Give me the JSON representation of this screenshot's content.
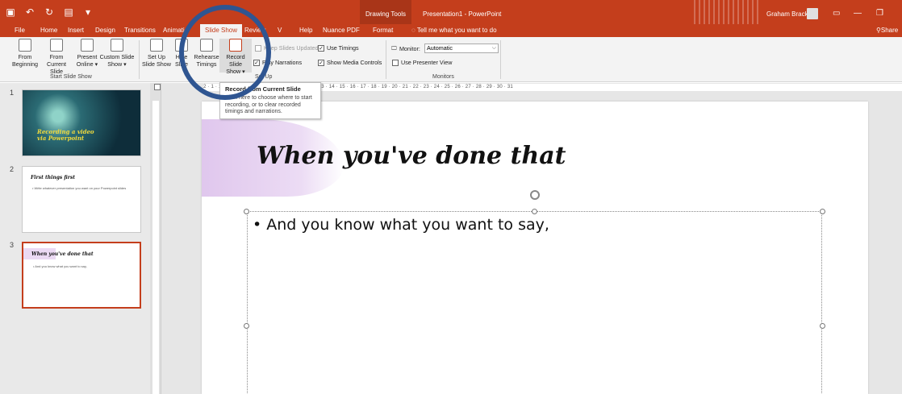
{
  "titlebar": {
    "qat_icons": [
      "save-icon",
      "undo-icon",
      "redo-icon",
      "start-from-beginning-icon",
      "customize-qat-icon"
    ],
    "contextual_tab": "Drawing Tools",
    "title": "Presentation1  -  PowerPoint",
    "user": "Graham Brack"
  },
  "tabs": {
    "items": [
      "File",
      "Home",
      "Insert",
      "Design",
      "Transitions",
      "Animati",
      "Slide Show",
      "Review",
      "V",
      "Help",
      "Nuance PDF",
      "Format"
    ],
    "active": "Slide Show",
    "tell_me": "Tell me what you want to do",
    "share": "Share"
  },
  "ribbon": {
    "from_beginning": [
      "From",
      "Beginning"
    ],
    "from_current": [
      "From",
      "Current Slide"
    ],
    "present_online": [
      "Present",
      "Online ▾"
    ],
    "custom_show": [
      "Custom Slide",
      "Show ▾"
    ],
    "group_start": "Start Slide Show",
    "set_up_show": [
      "Set Up",
      "Slide Show"
    ],
    "hide_slide": [
      "Hide",
      "Slide"
    ],
    "rehearse": [
      "Rehearse",
      "Timings"
    ],
    "record": [
      "Record Slide",
      "Show ▾"
    ],
    "keep_updated": "Keep Slides Updated",
    "play_narrations": "Play Narrations",
    "use_timings": "Use Timings",
    "show_media": "Show Media Controls",
    "group_setup": "Set Up",
    "monitor_label": "Monitor:",
    "monitor_value": "Automatic",
    "presenter_view": "Use Presenter View",
    "group_monitors": "Monitors"
  },
  "tooltip": {
    "title": "Record from Current Slide",
    "body": "Click here to choose where to start recording, or to clear recorded timings and narrations."
  },
  "thumbnails": [
    {
      "num": "1",
      "title": "Recording a video via Powerpoint"
    },
    {
      "num": "2",
      "title": "First things first",
      "bullet": "• Write whatever presentation you want on your Powerpoint slides"
    },
    {
      "num": "3",
      "title": "When you've done that",
      "bullet": "• And you know what you want to say,"
    }
  ],
  "ruler": {
    "numbers": "2 · 1 · 1 · 2 · 3 · 4 · 5 · 6 · 7 · 8 · 9 · 10 · 11 · 12 · 13 · 14 · 15 · 16 · 17 · 18 · 19 · 20 · 21 · 22 · 23 · 24 · 25 · 26 · 27 · 28 · 29 · 30 · 31"
  },
  "slide": {
    "title": "When you've done that",
    "bullet": "• And you know what you want to say,"
  },
  "colors": {
    "accent": "#c43e1c",
    "highlight_circle": "#2f5591"
  }
}
